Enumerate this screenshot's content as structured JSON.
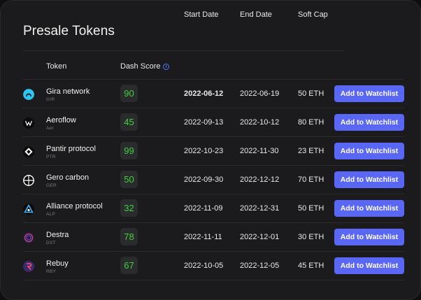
{
  "title": "Presale Tokens",
  "headers": {
    "token": "Token",
    "dash_score": "Dash Score",
    "start_date": "Start Date",
    "end_date": "End Date",
    "soft_cap": "Soft Cap"
  },
  "accent": "#5a67f4",
  "score_color": "#3fd13f",
  "rows": [
    {
      "name": "Gira network",
      "symbol": "GIR",
      "icon": "gira-logo-icon",
      "score": "90",
      "start": "2022-06-12",
      "end": "2022-06-19",
      "cap": "50 ETH",
      "action": "Add to Watchlist"
    },
    {
      "name": "Aeroflow",
      "symbol": "Aer",
      "icon": "aeroflow-logo-icon",
      "score": "45",
      "start": "2022-09-13",
      "end": "2022-10-12",
      "cap": "80 ETH",
      "action": "Add to Watchlist"
    },
    {
      "name": "Pantir protocol",
      "symbol": "PTR",
      "icon": "pantir-logo-icon",
      "score": "99",
      "start": "2022-10-23",
      "end": "2022-11-30",
      "cap": "23 ETH",
      "action": "Add to Watchlist"
    },
    {
      "name": "Gero carbon",
      "symbol": "GER",
      "icon": "gero-logo-icon",
      "score": "50",
      "start": "2022-09-30",
      "end": "2022-12-12",
      "cap": "70 ETH",
      "action": "Add to Watchlist"
    },
    {
      "name": "Alliance protocol",
      "symbol": "ALP",
      "icon": "alliance-logo-icon",
      "score": "32",
      "start": "2022-11-09",
      "end": "2022-12-31",
      "cap": "50 ETH",
      "action": "Add to Watchlist"
    },
    {
      "name": "Destra",
      "symbol": "DST",
      "icon": "destra-logo-icon",
      "score": "78",
      "start": "2022-11-11",
      "end": "2022-12-01",
      "cap": "30 ETH",
      "action": "Add to Watchlist"
    },
    {
      "name": "Rebuy",
      "symbol": "RBY",
      "icon": "rebuy-logo-icon",
      "score": "67",
      "start": "2022-10-05",
      "end": "2022-12-05",
      "cap": "45 ETH",
      "action": "Add to Watchlist"
    }
  ]
}
